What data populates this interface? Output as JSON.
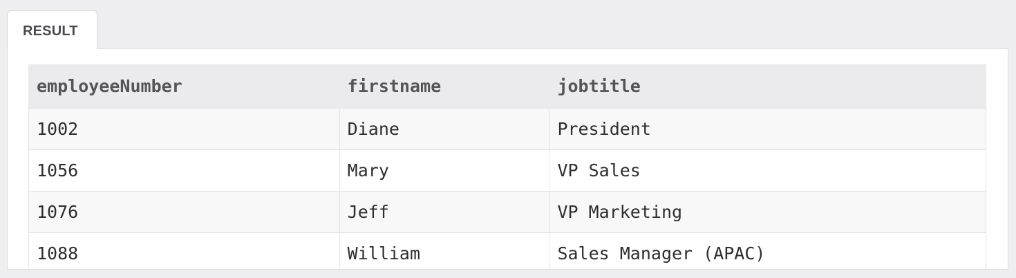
{
  "tab": {
    "label": "RESULT"
  },
  "table": {
    "columns": [
      "employeeNumber",
      "firstname",
      "jobtitle"
    ],
    "rows": [
      [
        "1002",
        "Diane",
        "President"
      ],
      [
        "1056",
        "Mary",
        "VP Sales"
      ],
      [
        "1076",
        "Jeff",
        "VP Marketing"
      ],
      [
        "1088",
        "William",
        "Sales Manager (APAC)"
      ]
    ]
  },
  "colors": {
    "page_background": "#eeeef0",
    "header_background": "#ebebed",
    "odd_row_background": "#f8f8f8",
    "even_row_background": "#ffffff",
    "text": "#2e2e30"
  }
}
